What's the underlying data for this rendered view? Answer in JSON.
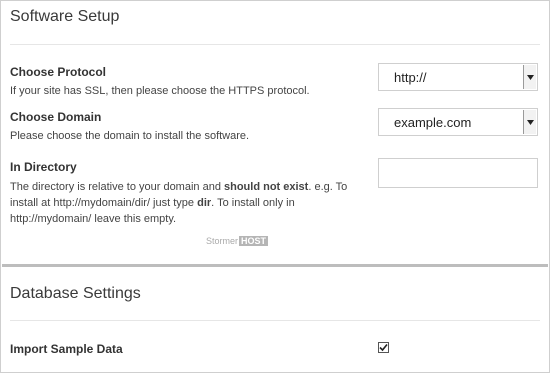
{
  "software_setup": {
    "title": "Software Setup",
    "protocol": {
      "label": "Choose Protocol",
      "help": "If your site has SSL, then please choose the HTTPS protocol.",
      "value": "http://"
    },
    "domain": {
      "label": "Choose Domain",
      "help": "Please choose the domain to install the software.",
      "value": "example.com"
    },
    "directory": {
      "label": "In Directory",
      "help_parts": {
        "a": "The directory is relative to your domain and ",
        "b": "should not exist",
        "c": ". e.g. To install at http://mydomain/dir/ just type ",
        "d": "dir",
        "e": ". To install only in http://mydomain/ leave this empty."
      },
      "value": ""
    },
    "watermark": {
      "left": "Stormer",
      "right": "HOST"
    }
  },
  "database_settings": {
    "title": "Database Settings",
    "import_sample": {
      "label": "Import Sample Data",
      "checked": true
    }
  }
}
